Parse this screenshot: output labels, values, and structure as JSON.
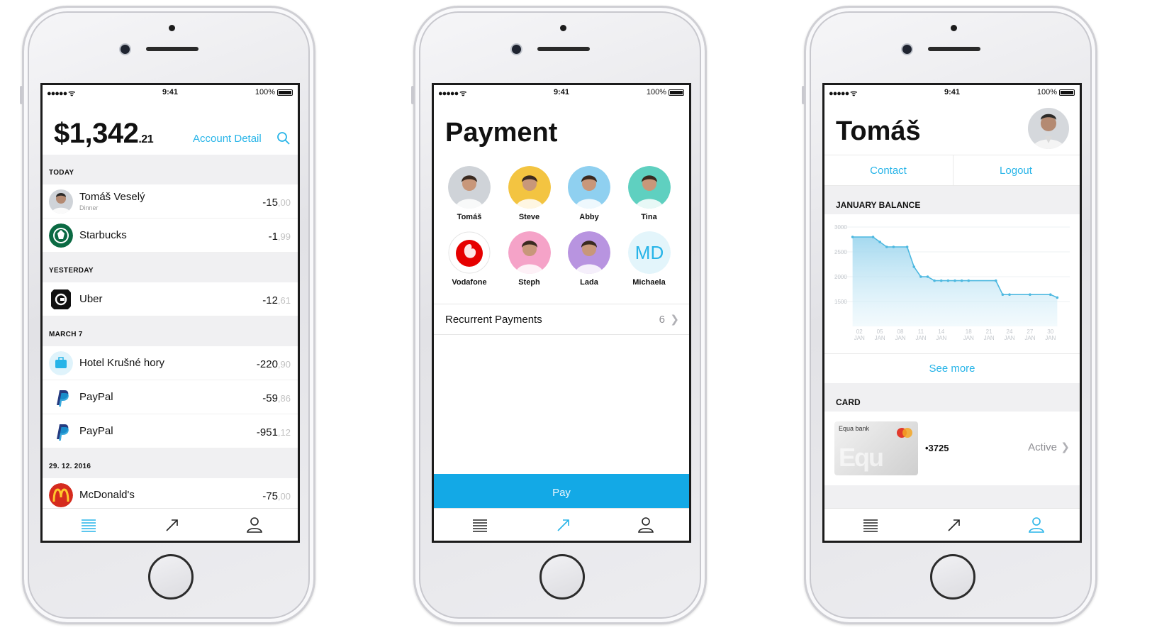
{
  "status": {
    "carrier": "●●●●● ᯤ",
    "time": "9:41",
    "battery": "100%"
  },
  "accent_color": "#13a9e6",
  "screen1": {
    "balance_main": "$1,342",
    "balance_cents": ".21",
    "account_link": "Account Detail",
    "sections": [
      {
        "title": "TODAY",
        "rows": [
          {
            "name": "Tomáš Veselý",
            "sub": "Dinner",
            "amount": "-15",
            "cents": ",00",
            "icon": "avatar-icon"
          },
          {
            "name": "Starbucks",
            "sub": "",
            "amount": "-1",
            "cents": ",99",
            "icon": "starbucks-icon"
          }
        ]
      },
      {
        "title": "YESTERDAY",
        "rows": [
          {
            "name": "Uber",
            "sub": "",
            "amount": "-12",
            "cents": ",61",
            "icon": "uber-icon"
          }
        ]
      },
      {
        "title": "MARCH 7",
        "rows": [
          {
            "name": "Hotel Krušné hory",
            "sub": "",
            "amount": "-220",
            "cents": ",90",
            "icon": "hotel-icon"
          },
          {
            "name": "PayPal",
            "sub": "",
            "amount": "-59",
            "cents": ",86",
            "icon": "paypal-icon"
          },
          {
            "name": "PayPal",
            "sub": "",
            "amount": "-951",
            "cents": ",12",
            "icon": "paypal-icon"
          }
        ]
      },
      {
        "title": "29. 12. 2016",
        "rows": [
          {
            "name": "McDonald's",
            "sub": "",
            "amount": "-75",
            "cents": ",00",
            "icon": "mcdonalds-icon"
          }
        ]
      }
    ]
  },
  "screen2": {
    "title": "Payment",
    "contacts": [
      {
        "name": "Tomáš",
        "color": "#cfd3d8"
      },
      {
        "name": "Steve",
        "color": "#f3c441"
      },
      {
        "name": "Abby",
        "color": "#8fd0f0"
      },
      {
        "name": "Tina",
        "color": "#5fd0c0"
      },
      {
        "name": "Vodafone",
        "color": "#ffffff"
      },
      {
        "name": "Steph",
        "color": "#f5a3c8"
      },
      {
        "name": "Lada",
        "color": "#b894e0"
      },
      {
        "name": "Michaela",
        "color": "#e3f5fb",
        "initials": "MD"
      }
    ],
    "recurrent_label": "Recurrent Payments",
    "recurrent_count": "6",
    "pay_label": "Pay"
  },
  "screen3": {
    "name": "Tomáš",
    "contact_label": "Contact",
    "logout_label": "Logout",
    "balance_section": "JANUARY BALANCE",
    "see_more": "See more",
    "card_section": "CARD",
    "card_bank": "Equa bank",
    "card_big": "Equ",
    "card_number": "•3725",
    "card_status": "Active"
  },
  "chart_data": {
    "type": "area",
    "title": "",
    "y_ticks": [
      "3000",
      "2500",
      "2000",
      "1500"
    ],
    "ylim": [
      1000,
      3000
    ],
    "x_ticks": [
      {
        "day": "02",
        "mon": "JAN"
      },
      {
        "day": "05",
        "mon": "JAN"
      },
      {
        "day": "08",
        "mon": "JAN"
      },
      {
        "day": "11",
        "mon": "JAN"
      },
      {
        "day": "14",
        "mon": "JAN"
      },
      {
        "day": "18",
        "mon": "JAN"
      },
      {
        "day": "21",
        "mon": "JAN"
      },
      {
        "day": "24",
        "mon": "JAN"
      },
      {
        "day": "27",
        "mon": "JAN"
      },
      {
        "day": "30",
        "mon": "JAN"
      }
    ],
    "x": [
      1,
      4,
      5,
      6,
      7,
      9,
      10,
      11,
      12,
      13,
      14,
      15,
      16,
      17,
      18,
      22,
      23,
      24,
      27,
      30,
      31
    ],
    "y": [
      2800,
      2800,
      2700,
      2600,
      2600,
      2600,
      2200,
      2000,
      2000,
      1920,
      1920,
      1920,
      1920,
      1920,
      1920,
      1920,
      1640,
      1640,
      1640,
      1640,
      1580
    ],
    "grid": true,
    "color": "#4db8e0"
  }
}
